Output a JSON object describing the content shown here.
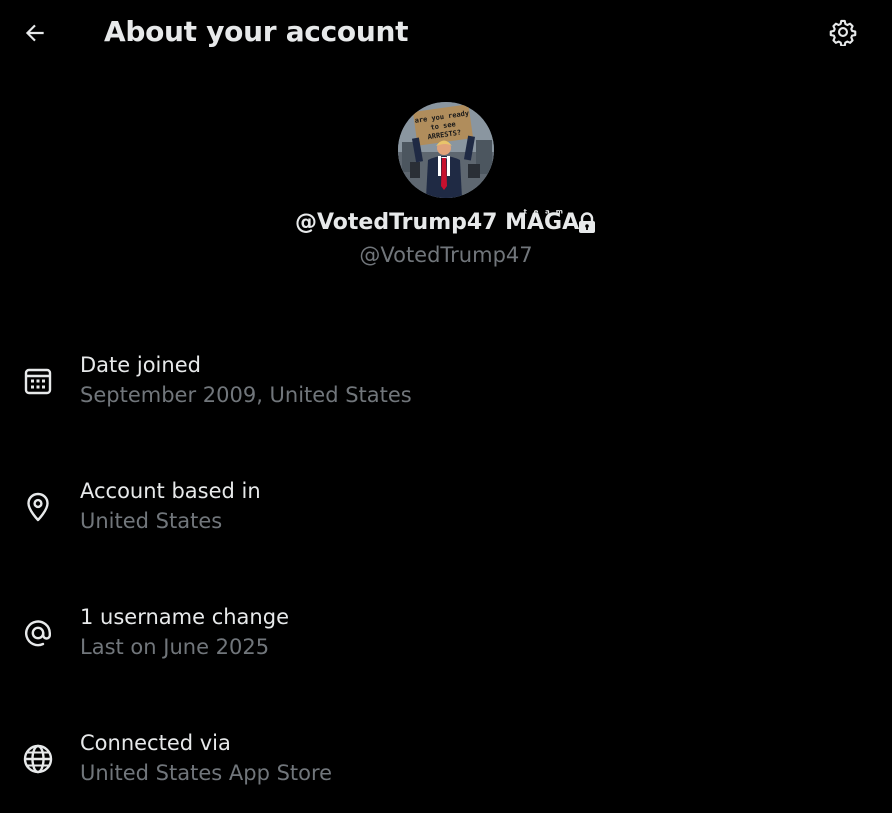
{
  "header": {
    "title": "About your account",
    "back_icon": "arrow-left-icon",
    "settings_icon": "gear-icon"
  },
  "profile": {
    "display_name": "@VotedTrump47 MAGA",
    "display_name_mark": "ᵗᵉᵃᵐ",
    "handle": "@VotedTrump47",
    "protected_icon": "lock-icon",
    "avatar_sign_text": "are you ready to see ARRESTS?"
  },
  "items": [
    {
      "icon": "calendar-icon",
      "label": "Date joined",
      "value": "September 2009, United States"
    },
    {
      "icon": "location-pin-icon",
      "label": "Account based in",
      "value": "United States"
    },
    {
      "icon": "at-sign-icon",
      "label": "1 username change",
      "value": "Last on June 2025"
    },
    {
      "icon": "globe-icon",
      "label": "Connected via",
      "value": "United States App Store"
    }
  ],
  "colors": {
    "background": "#000000",
    "primary_text": "#e7e9ea",
    "secondary_text": "#71767b"
  }
}
